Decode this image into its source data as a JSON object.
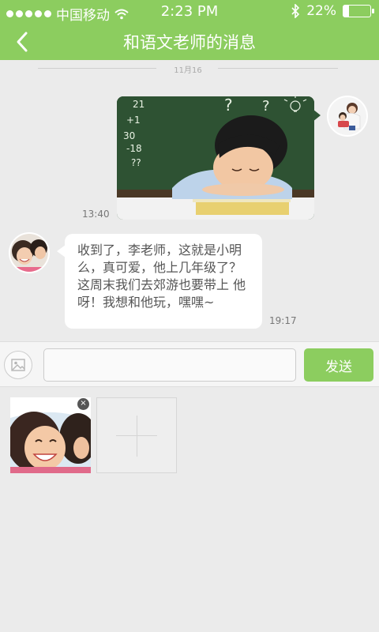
{
  "status_bar": {
    "carrier": "中国移动",
    "time": "2:23 PM",
    "battery_percent": "22%",
    "battery_level": 0.22,
    "icons": [
      "signal-dots",
      "wifi-icon",
      "bluetooth-icon",
      "battery-icon"
    ]
  },
  "nav": {
    "title": "和语文老师的消息",
    "back_icon": "chevron-left-icon"
  },
  "conversation": {
    "date_divider": "11月16",
    "messages": [
      {
        "sender": "self",
        "type": "image",
        "time": "13:40",
        "image_text": {
          "q1": "?",
          "q2": "?",
          "math": [
            "21",
            "+1",
            "30",
            "-18",
            "??"
          ]
        }
      },
      {
        "sender": "teacher",
        "type": "text",
        "time": "19:17",
        "text": "收到了，李老师，这就是小明么，真可爱，他上几年级了？这周末我们去郊游也要带上 他呀！我想和他玩，嘿嘿~"
      }
    ]
  },
  "composer": {
    "input_value": "",
    "input_placeholder": "",
    "send_label": "发送",
    "image_icon": "image-icon"
  },
  "attachments": {
    "remove_label": "×",
    "add_icon": "plus-icon"
  },
  "colors": {
    "brand_green": "#8ccd5f",
    "background": "#ebebeb",
    "bubble_white": "#ffffff"
  }
}
